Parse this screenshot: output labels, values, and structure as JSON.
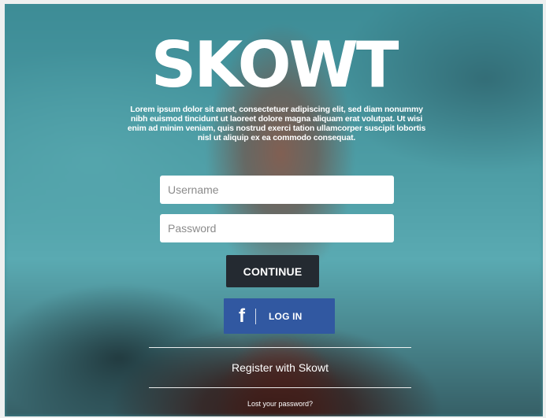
{
  "brand": {
    "logo_text": "SKOWT"
  },
  "intro": {
    "text": "Lorem ipsum dolor sit amet, consectetuer adipiscing elit, sed diam nonummy nibh euismod tincidunt ut laoreet dolore magna aliquam erat volutpat. Ut wisi enim ad minim veniam, quis nostrud exerci tation ullamcorper suscipit lobortis nisl ut aliquip ex ea commodo consequat."
  },
  "form": {
    "username_placeholder": "Username",
    "password_placeholder": "Password",
    "continue_label": "CONTINUE"
  },
  "facebook": {
    "icon": "facebook-icon",
    "glyph": "f",
    "label": "LOG IN",
    "color": "#3158a1"
  },
  "links": {
    "register": "Register with Skowt",
    "lost_password": "Lost your password?"
  },
  "colors": {
    "button_dark": "#242a31",
    "background_teal": "#4e9ea6"
  }
}
